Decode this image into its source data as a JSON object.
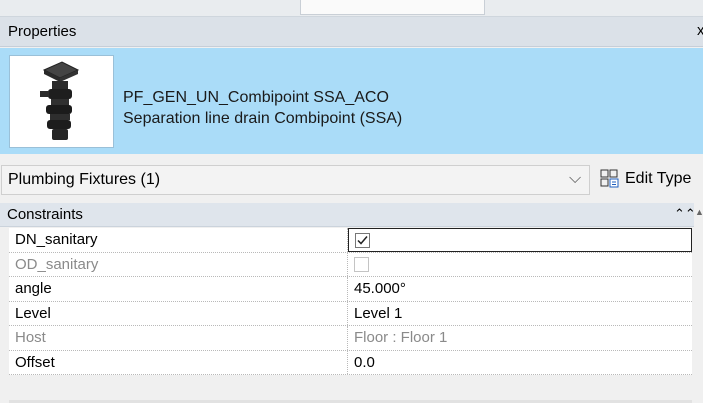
{
  "panel": {
    "title": "Properties",
    "close_glyph": "x"
  },
  "type_selector": {
    "thumbnail_icon": "drain-fixture-icon",
    "family_name": "PF_GEN_UN_Combipoint SSA_ACO",
    "type_name": "Separation line drain Combipoint (SSA)"
  },
  "instance_filter": {
    "value": "Plumbing Fixtures (1)",
    "dropdown_icon": "chevron-down-icon"
  },
  "edit_type": {
    "label": "Edit Type",
    "icon": "edit-type-icon"
  },
  "group": {
    "label": "Constraints",
    "collapse_glyph": "⌃⌃"
  },
  "rows": [
    {
      "name": "DN_sanitary",
      "checked": true
    },
    {
      "name": "OD_sanitary",
      "checked": false
    },
    {
      "name": "angle",
      "value": "45.000°"
    },
    {
      "name": "Level",
      "value": "Level 1"
    },
    {
      "name": "Host",
      "value": "Floor : Floor 1"
    },
    {
      "name": "Offset",
      "value": "0.0"
    }
  ],
  "colors": {
    "type_box": "#aadcf8",
    "header": "#dbe1e8",
    "group": "#dfe5ec"
  }
}
